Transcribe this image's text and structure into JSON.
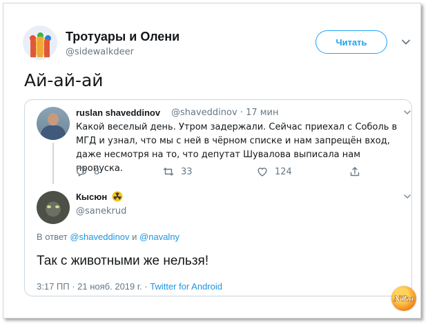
{
  "tweet": {
    "account_name": "Тротуары и Олени",
    "account_handle": "@sidewalkdeer",
    "follow_label": "Читать",
    "text": "Ай-ай-ай"
  },
  "quoted": {
    "tweet": {
      "name": "ruslan shaveddinov",
      "handle_time": "@shaveddinov · 17 мин",
      "body": "Какой веселый день. Утром задержали. Сейчас приехал с Соболь в МГД и узнал, что мы с ней в чёрном списке и нам запрещён вход, даже несмотря на то, что депутат Шувалова выписала нам пропуска.",
      "replies": "8",
      "retweets": "33",
      "likes": "124"
    },
    "reply": {
      "name": "Кысюн",
      "handle": "@sanekrud",
      "reply_prefix": "В ответ",
      "mention1": "@shaveddinov",
      "reply_and": "и",
      "mention2": "@navalny",
      "text": "Так с животными же нельзя!",
      "timestamp": "3:17 ПП · 21 нояб. 2019 г. ·",
      "client": "Twitter for Android"
    }
  },
  "watermark": {
    "text": "Nika"
  },
  "colors": {
    "accent": "#1da1f2",
    "link": "#1b95e0",
    "secondary_text": "#657786",
    "border": "#ccd6dd"
  },
  "icons": [
    "caret-down-icon",
    "reply-icon",
    "retweet-icon",
    "like-icon",
    "share-icon",
    "radiation-badge-icon"
  ]
}
